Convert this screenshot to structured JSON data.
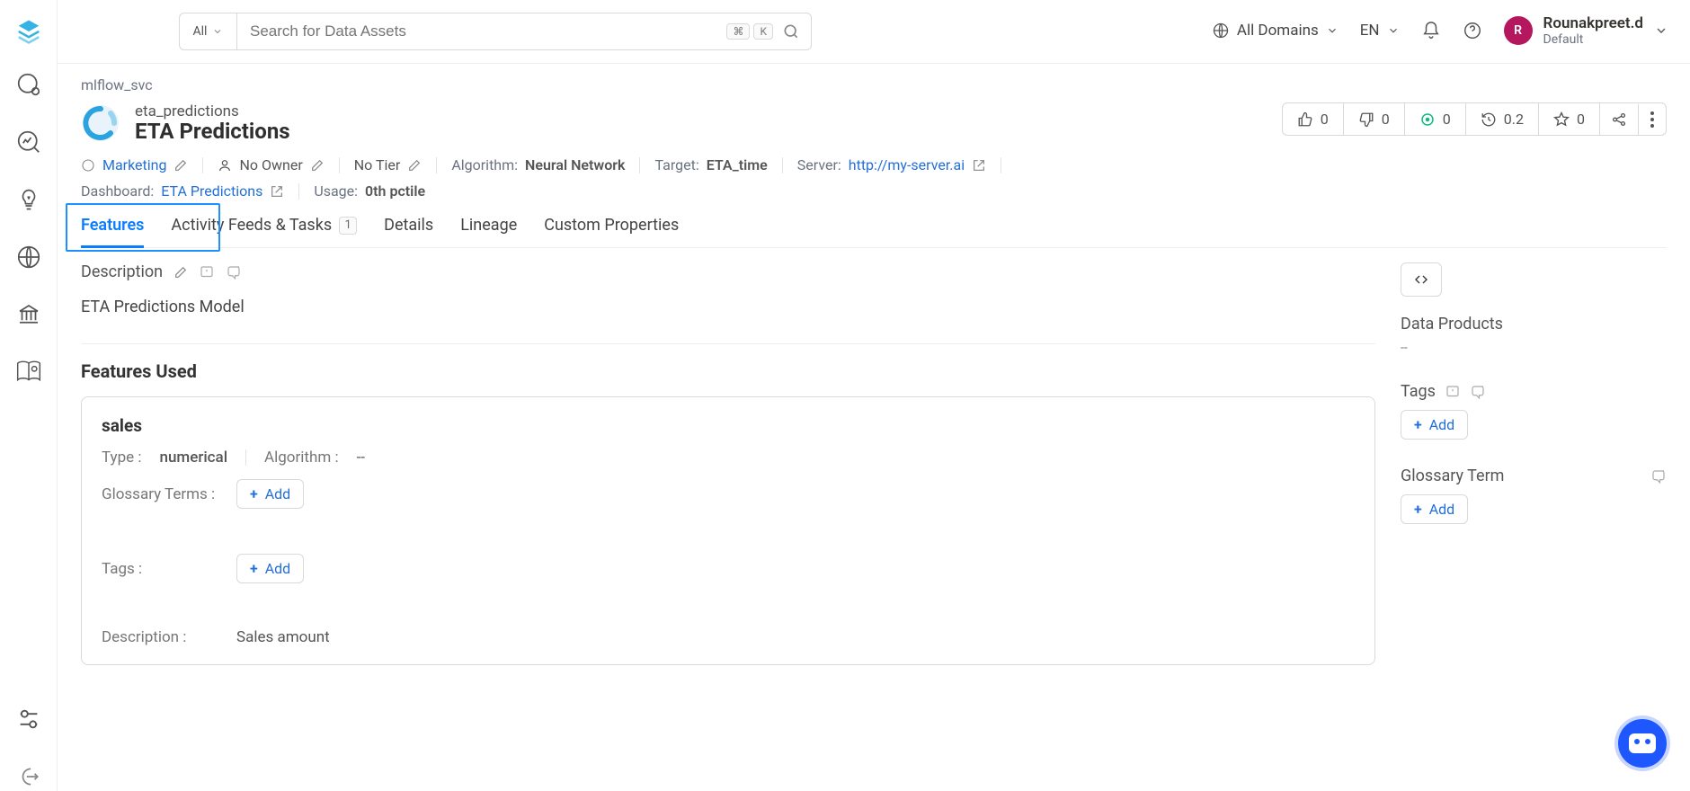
{
  "topbar": {
    "search_scope": "All",
    "search_placeholder": "Search for Data Assets",
    "shortcut": [
      "⌘",
      "K"
    ],
    "domain_label": "All Domains",
    "lang": "EN",
    "user": {
      "initial": "R",
      "name": "Rounakpreet.d",
      "role": "Default"
    }
  },
  "breadcrumb": "mlflow_svc",
  "entity": {
    "slug": "eta_predictions",
    "title": "ETA Predictions"
  },
  "stats": {
    "upvotes": "0",
    "downvotes": "0",
    "tasks_open": "0",
    "freshness": "0.2",
    "stars": "0"
  },
  "meta": {
    "domain": "Marketing",
    "owner": "No Owner",
    "tier": "No Tier",
    "algorithm_label": "Algorithm:",
    "algorithm_value": "Neural Network",
    "target_label": "Target:",
    "target_value": "ETA_time",
    "server_label": "Server:",
    "server_value": "http://my-server.ai",
    "dashboard_label": "Dashboard:",
    "dashboard_value": "ETA Predictions",
    "usage_label": "Usage:",
    "usage_value": "0th pctile"
  },
  "tabs": {
    "features": "Features",
    "activity": "Activity Feeds & Tasks",
    "activity_count": "1",
    "details": "Details",
    "lineage": "Lineage",
    "custom": "Custom Properties"
  },
  "description": {
    "heading": "Description",
    "body": "ETA Predictions Model"
  },
  "features_used": {
    "heading": "Features Used",
    "items": [
      {
        "name": "sales",
        "type_label": "Type :",
        "type_value": "numerical",
        "algo_label": "Algorithm :",
        "algo_value": "--",
        "glossary_label": "Glossary Terms :",
        "tags_label": "Tags :",
        "desc_label": "Description :",
        "desc_value": "Sales amount",
        "add_label": "Add"
      }
    ]
  },
  "side": {
    "data_products_h": "Data Products",
    "data_products_v": "--",
    "tags_h": "Tags",
    "glossary_h": "Glossary Term",
    "add_label": "Add"
  }
}
